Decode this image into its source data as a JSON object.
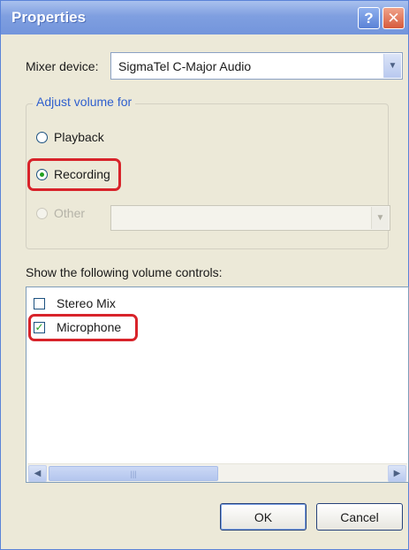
{
  "window": {
    "title": "Properties",
    "help_glyph": "?",
    "close_glyph": "✕"
  },
  "mixer": {
    "label": "Mixer device:",
    "value": "SigmaTel C-Major Audio"
  },
  "adjust": {
    "title": "Adjust volume for",
    "options": [
      {
        "label": "Playback",
        "checked": false,
        "enabled": true
      },
      {
        "label": "Recording",
        "checked": true,
        "enabled": true
      },
      {
        "label": "Other",
        "checked": false,
        "enabled": false
      }
    ],
    "other_value": ""
  },
  "controls": {
    "label": "Show the following volume controls:",
    "items": [
      {
        "label": "Stereo Mix",
        "checked": false
      },
      {
        "label": "Microphone",
        "checked": true
      }
    ]
  },
  "icons": {
    "dropdown": "chevron-down-icon",
    "scroll_left": "chevron-left-icon",
    "scroll_right": "chevron-right-icon"
  },
  "buttons": {
    "ok": "OK",
    "cancel": "Cancel"
  },
  "colors": {
    "titlebar": "#7f9fe0",
    "group_title": "#2f5fce",
    "highlight": "#d8232a",
    "check": "#21a121"
  }
}
